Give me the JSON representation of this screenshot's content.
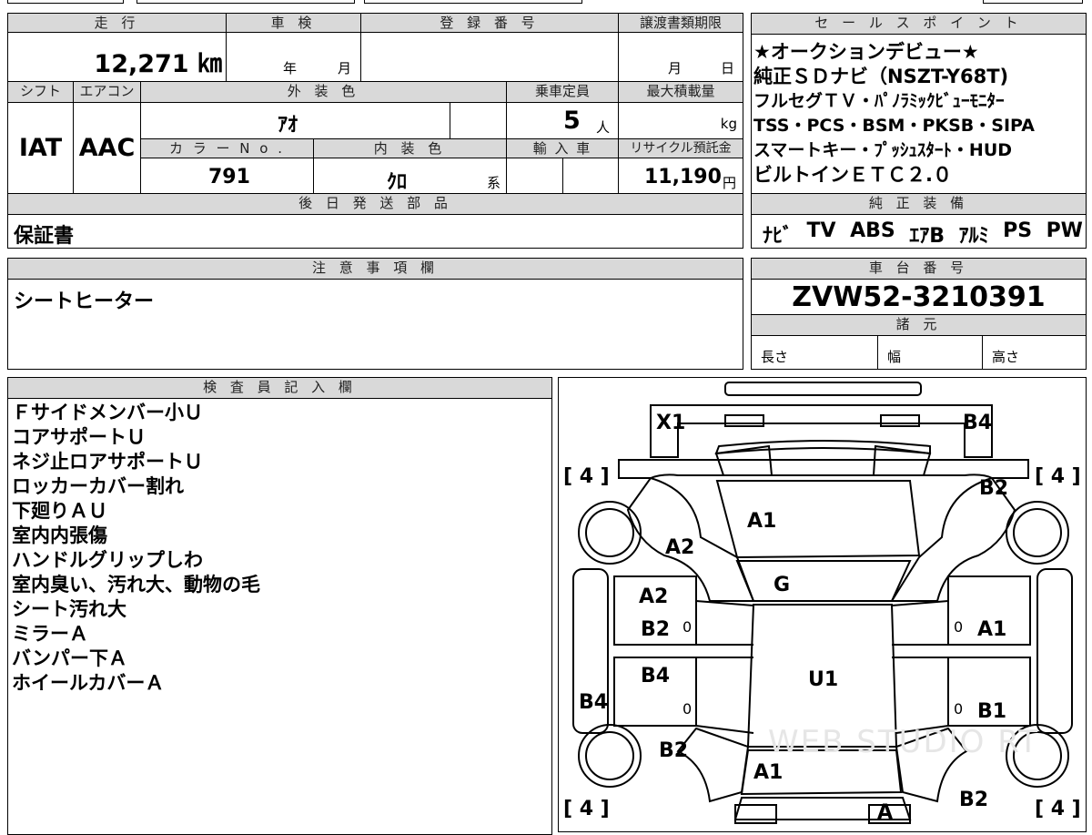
{
  "main": {
    "headers": {
      "mileage": "走 行",
      "inspection": "車 検",
      "registration": "登 録 番 号",
      "transfer_deadline": "譲渡書類期限",
      "shift": "シフト",
      "aircon": "エアコン",
      "exterior_color": "外 装 色",
      "capacity": "乗車定員",
      "max_load": "最大積載量",
      "color_no": "カ ラ ー N o .",
      "interior_color": "内 装 色",
      "import": "輸 入 車",
      "recycle": "リサイクル預託金",
      "later_parts": "後 日 発 送 部 品",
      "notes": "注 意 事 項 欄",
      "inspector": "検 査 員 記 入 欄"
    },
    "mileage": "12,271 ㎞",
    "inspection_year": "年",
    "inspection_month": "月",
    "deadline_month": "月",
    "deadline_day": "日",
    "shift": "IAT",
    "aircon": "AAC",
    "exterior_color": "ｱｵ",
    "capacity": "5",
    "capacity_unit": "人",
    "max_load_unit": "kg",
    "color_no": "791",
    "interior_color": "ｸﾛ",
    "interior_suffix": "系",
    "recycle_value": "11,190",
    "recycle_unit": "円",
    "later_parts_value": "保証書",
    "notes_value": "シートヒーター",
    "inspector_lines": [
      "Ｆサイドメンバー小Ｕ",
      "コアサポートＵ",
      "ネジ止ロアサポートＵ",
      "ロッカーカバー割れ",
      "下廻りＡＵ",
      "室内内張傷",
      "ハンドルグリップしわ",
      "室内臭い、汚れ大、動物の毛",
      "シート汚れ大",
      "ミラーＡ",
      "バンパー下Ａ",
      "ホイールカバーＡ"
    ]
  },
  "side": {
    "sales_header": "セ ー ル ス ポ イ ン ト",
    "sales_points": [
      "★オークションデビュー★",
      "純正ＳＤナビ（NSZT-Y68T)",
      "フルセグＴＶ・ﾊﾟﾉﾗﾐｯｸﾋﾞｭｰﾓﾆﾀｰ",
      "TSS・PCS・BSM・PKSB・SIPA",
      "スマートキー・ﾌﾟｯｼｭｽﾀｰﾄ・HUD",
      "ビルトインＥＴＣ２.０"
    ],
    "equipment_header": "純 正 装 備",
    "equipment": [
      "ﾅﾋﾞ",
      "TV",
      "ABS",
      "ｴｱB",
      "ｱﾙﾐ",
      "PS",
      "PW"
    ],
    "chassis_header": "車 台 番 号",
    "chassis_number": "ZVW52-3210391",
    "specs_header": "諸 元",
    "spec_length": "長さ",
    "spec_width": "幅",
    "spec_height": "高さ"
  },
  "diagram": {
    "tire_tl": "[ 4 ]",
    "tire_tr": "[ 4 ]",
    "tire_bl": "[ 4 ]",
    "tire_br": "[ 4 ]",
    "zero": "0",
    "labels": {
      "x1": "X1",
      "b4_top": "B4",
      "b2_tr": "B2",
      "a1_hood": "A1",
      "a2_fl": "A2",
      "g_windshield": "G",
      "a2_door_fl": "A2",
      "b2_door_fl": "B2",
      "a1_door_fr": "A1",
      "u1_roof": "U1",
      "b4_door_rl": "B4",
      "b1_door_rr": "B1",
      "b4_left": "B4",
      "b2_rl": "B2",
      "a1_trunk": "A1",
      "b2_br": "B2",
      "a_rear": "A"
    },
    "watermark": "WEB STUDIO RT",
    "colors": {
      "line": "#000000",
      "header_bg": "#d9d9d9",
      "watermark": "#e6e6e6"
    }
  }
}
